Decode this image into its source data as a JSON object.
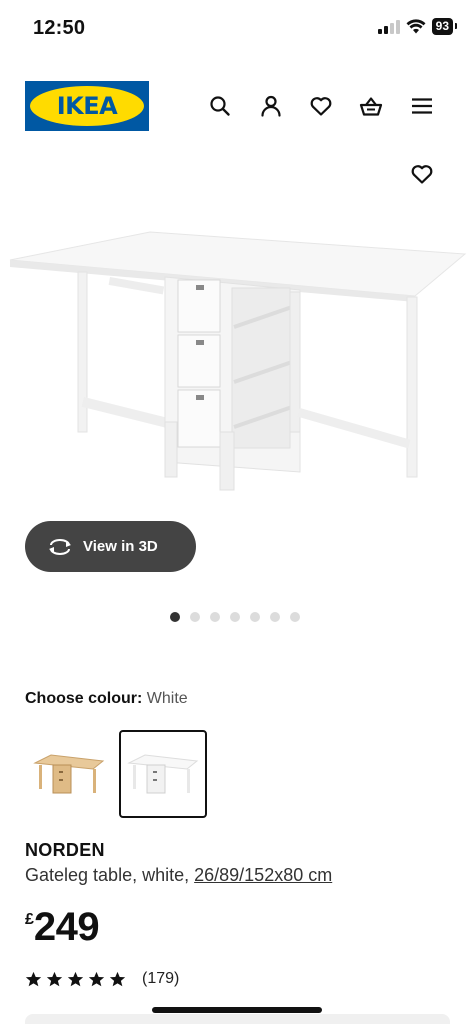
{
  "status_bar": {
    "time": "12:50",
    "battery": "93"
  },
  "header": {
    "logo_text": "IKEA",
    "icons": [
      "search-icon",
      "account-icon",
      "favourites-icon",
      "basket-icon",
      "menu-icon"
    ]
  },
  "product_image": {
    "alt": "NORDEN gateleg table, white"
  },
  "view3d": {
    "label": "View in 3D"
  },
  "carousel": {
    "total": 7,
    "active_index": 0
  },
  "colour": {
    "label": "Choose colour:",
    "value": "White",
    "options": [
      "Birch",
      "White"
    ],
    "selected": "White"
  },
  "product": {
    "name": "NORDEN",
    "description": "Gateleg table, white,",
    "dimensions": "26/89/152x80 cm",
    "currency": "£",
    "price": "249",
    "rating": 5,
    "review_count": "(179)"
  },
  "colors": {
    "ikea_blue": "#0058a3",
    "ikea_yellow": "#ffdb00",
    "view3d_bg": "#444444"
  }
}
